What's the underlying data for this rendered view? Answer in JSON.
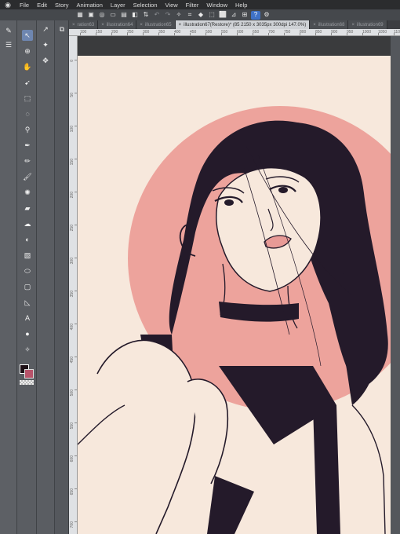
{
  "menubar": {
    "apple_icon": "app-icon",
    "items": [
      "File",
      "Edit",
      "Story",
      "Animation",
      "Layer",
      "Selection",
      "View",
      "Filter",
      "Window",
      "Help"
    ]
  },
  "tabs": [
    {
      "label": "ration63",
      "active": false
    },
    {
      "label": "illustration64",
      "active": false
    },
    {
      "label": "illustration65",
      "active": false
    },
    {
      "label": "illustration67(Restore)* (85 2150 x 3035px 300dpi 147.0%)",
      "active": true
    },
    {
      "label": "illustration68",
      "active": false
    },
    {
      "label": "illustration69",
      "active": false
    }
  ],
  "ruler": {
    "top_ticks": [
      "100",
      "150",
      "200",
      "250",
      "300",
      "350",
      "400",
      "450",
      "500",
      "550",
      "600",
      "650",
      "700",
      "750",
      "800",
      "850",
      "900",
      "950",
      "1000",
      "1050",
      "1100"
    ],
    "left_ticks": [
      "0",
      "50",
      "100",
      "150",
      "200",
      "250",
      "300",
      "350",
      "400",
      "450",
      "500",
      "550",
      "600",
      "650",
      "700"
    ]
  },
  "colors": {
    "main_color": "#1d0f15",
    "sub_color": "#b8536a",
    "accent": "#3f71c6",
    "canvas_bg": "#f7e8dc",
    "sun_circle": "#eda39c",
    "ink": "#241a2a"
  },
  "tools": [
    "move-icon",
    "zoom-icon",
    "hand-icon",
    "operation-icon",
    "selection-icon",
    "lasso-icon",
    "eyedropper-icon",
    "pen-icon",
    "pencil-icon",
    "brush-icon",
    "airbrush-icon",
    "eraser-icon",
    "blend-icon",
    "fill-icon",
    "gradient-icon",
    "figure-icon",
    "frame-icon",
    "ruler-icon",
    "text-icon",
    "balloon-icon",
    "correction-icon"
  ]
}
